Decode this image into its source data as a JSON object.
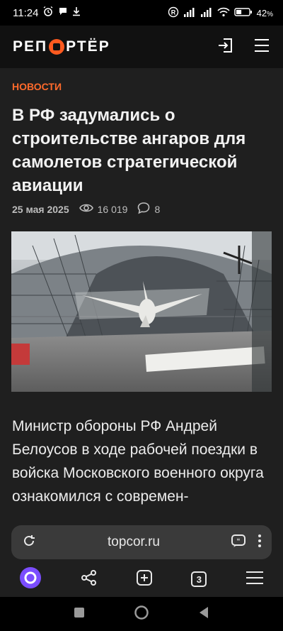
{
  "status_bar": {
    "time": "11:24",
    "battery": "42",
    "battery_unit": "%",
    "battery_level": 0.42,
    "icons": [
      "alarm-icon",
      "chat-bubble-icon",
      "download-icon",
      "registered-icon",
      "signal-icon",
      "signal-icon-2",
      "wifi-icon",
      "battery-icon"
    ]
  },
  "header": {
    "logo_left": "РЕП",
    "logo_right": "РТЁР",
    "icons": [
      "login-icon",
      "menu-icon"
    ]
  },
  "article": {
    "category": "НОВОСТИ",
    "title": "В РФ задумались о строительстве ангаров для самолетов стратегической авиации",
    "date": "25 мая 2025",
    "views": "16 019",
    "comments": "8",
    "body": "Министр обороны РФ Андрей Белоусов в ходе рабочей поездки в войска Московского военного округа ознакомился с современ-"
  },
  "browser": {
    "url": "topcor.ru",
    "tab_count": "3",
    "icons": [
      "reload-icon",
      "quote-icon",
      "more-icon",
      "alice-icon",
      "share-icon",
      "new-tab-icon",
      "tabs-icon",
      "browser-menu-icon"
    ]
  },
  "colors": {
    "accent": "#ff6a2b",
    "background": "#1f1f1f",
    "header": "#111111",
    "url_bar": "#3a3a3a",
    "alice": "#7b4dff"
  }
}
